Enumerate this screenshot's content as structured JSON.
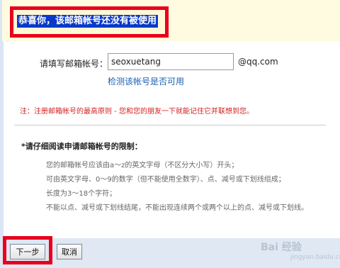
{
  "success": {
    "message": "恭喜你，该邮箱帐号还没有被使用"
  },
  "form": {
    "email_label": "请填写邮箱帐号：",
    "email_value": "seoxuetang",
    "domain": "@qq.com",
    "check_link": "检测该帐号是否可用",
    "note": "注：注册邮箱帐号的最高原则 - 您和您的朋友一下就能记住它并联想到您。"
  },
  "rules": {
    "title": "*请仔细阅读申请邮箱帐号的限制：",
    "items": [
      "您的邮箱帐号应该由a～z的英文字母（不区分大小写）开头；",
      "可由英文字母、0～9的数字（但不能使用全数字）、点、减号或下划线组成；",
      "长度为3～18个字符；",
      "不能以点、减号或下划线结尾，不能出现连续两个或两个以上的点、减号或下划线。"
    ]
  },
  "footer": {
    "next_label": "下一步",
    "cancel_label": "取消"
  },
  "watermark": {
    "text": "Bai 经验",
    "sub": "jingyan.baidu.com"
  },
  "colors": {
    "highlight_border": "#e8001c",
    "success_bg": "#0a39c8",
    "link": "#1a5fb4",
    "note": "#d42020"
  }
}
